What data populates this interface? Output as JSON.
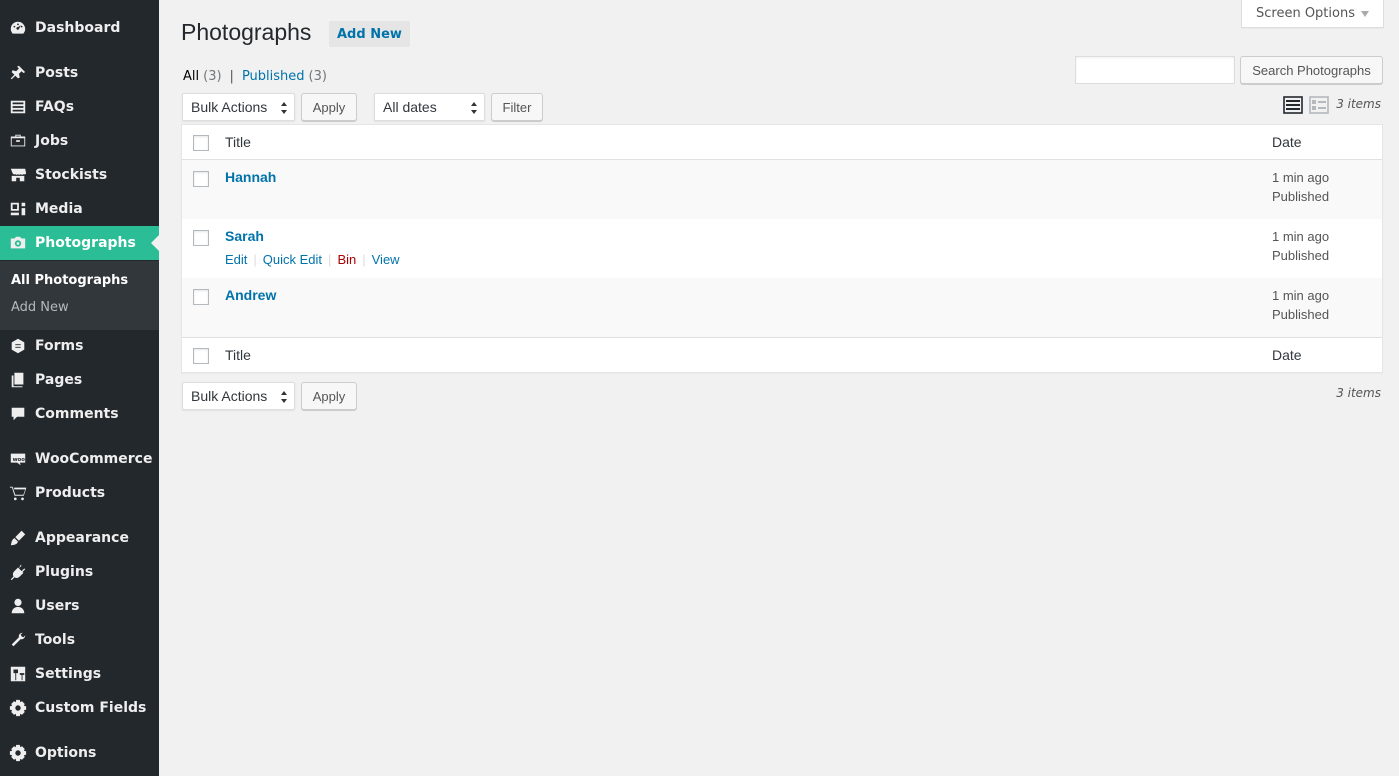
{
  "sidebar": {
    "items": [
      {
        "label": "Dashboard",
        "icon": "dashboard-icon"
      },
      {
        "label": "Posts",
        "icon": "pin-icon"
      },
      {
        "label": "FAQs",
        "icon": "list-icon"
      },
      {
        "label": "Jobs",
        "icon": "briefcase-icon"
      },
      {
        "label": "Stockists",
        "icon": "store-icon"
      },
      {
        "label": "Media",
        "icon": "media-icon"
      },
      {
        "label": "Photographs",
        "icon": "camera-icon"
      },
      {
        "label": "Forms",
        "icon": "forms-icon"
      },
      {
        "label": "Pages",
        "icon": "pages-icon"
      },
      {
        "label": "Comments",
        "icon": "comment-icon"
      },
      {
        "label": "WooCommerce",
        "icon": "woo-icon"
      },
      {
        "label": "Products",
        "icon": "cart-icon"
      },
      {
        "label": "Appearance",
        "icon": "brush-icon"
      },
      {
        "label": "Plugins",
        "icon": "plugin-icon"
      },
      {
        "label": "Users",
        "icon": "user-icon"
      },
      {
        "label": "Tools",
        "icon": "wrench-icon"
      },
      {
        "label": "Settings",
        "icon": "settings-icon"
      },
      {
        "label": "Custom Fields",
        "icon": "gear-icon"
      },
      {
        "label": "Options",
        "icon": "gear-icon"
      }
    ],
    "submenu": [
      "All Photographs",
      "Add New"
    ]
  },
  "header": {
    "title": "Photographs",
    "add_new": "Add New",
    "screen_options": "Screen Options"
  },
  "filters": {
    "all_label": "All",
    "all_count": "(3)",
    "separator": "|",
    "published_label": "Published",
    "published_count": "(3)"
  },
  "search": {
    "button": "Search Photographs",
    "value": ""
  },
  "toolbar": {
    "bulk_actions": "Bulk Actions",
    "apply": "Apply",
    "all_dates": "All dates",
    "filter": "Filter",
    "items_count": "3 items"
  },
  "table": {
    "headers": {
      "title": "Title",
      "date": "Date"
    },
    "rows": [
      {
        "title": "Hannah",
        "date": "1 min ago",
        "status": "Published"
      },
      {
        "title": "Sarah",
        "date": "1 min ago",
        "status": "Published"
      },
      {
        "title": "Andrew",
        "date": "1 min ago",
        "status": "Published"
      }
    ],
    "row_actions": [
      "Edit",
      "Quick Edit",
      "Bin",
      "View"
    ]
  },
  "colors": {
    "sidebar_bg": "#23282d",
    "active_bg": "#2bbd96",
    "link": "#0073aa",
    "delete": "#a00"
  }
}
